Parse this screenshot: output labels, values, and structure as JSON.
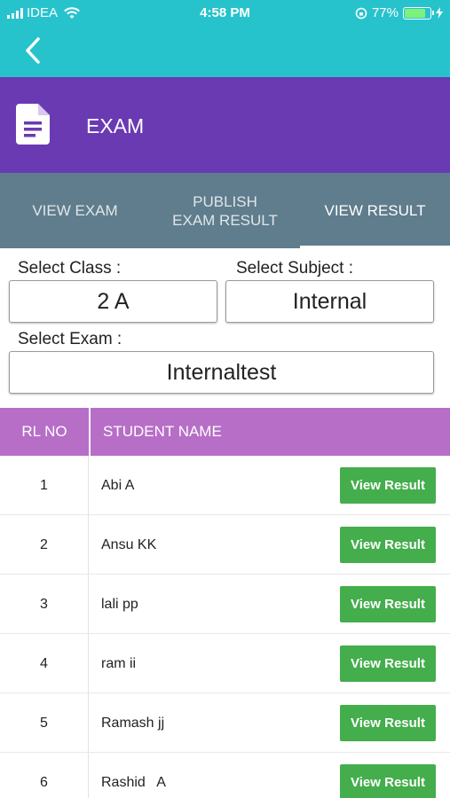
{
  "status_bar": {
    "carrier": "IDEA",
    "time": "4:58 PM",
    "battery": "77%",
    "icons": [
      "signal-icon",
      "wifi-icon",
      "orientation-lock-icon",
      "battery-icon",
      "charging-icon"
    ]
  },
  "nav": {
    "back_icon": "chevron-left-icon"
  },
  "header": {
    "icon": "document-icon",
    "title": "EXAM"
  },
  "tabs": [
    {
      "label": "VIEW EXAM",
      "active": false
    },
    {
      "label": "PUBLISH\nEXAM RESULT",
      "active": false
    },
    {
      "label": "VIEW RESULT",
      "active": true
    }
  ],
  "filters": {
    "class_label": "Select Class :",
    "class_value": "2 A",
    "subject_label": "Select Subject :",
    "subject_value": "Internal",
    "exam_label": "Select Exam :",
    "exam_value": "Internaltest"
  },
  "table": {
    "headers": [
      "RL NO",
      "STUDENT NAME"
    ],
    "rows": [
      {
        "rl": "1",
        "name": "Abi A",
        "button": "View Result"
      },
      {
        "rl": "2",
        "name": "Ansu KK",
        "button": "View Result"
      },
      {
        "rl": "3",
        "name": "lali pp",
        "button": "View Result"
      },
      {
        "rl": "4",
        "name": "ram ii",
        "button": "View Result"
      },
      {
        "rl": "5",
        "name": "Ramash jj",
        "button": "View Result"
      },
      {
        "rl": "6",
        "name": "Rashid   A",
        "button": "View Result"
      }
    ]
  },
  "colors": {
    "status_bar": "#27c3cc",
    "header": "#6a3ab3",
    "tabs": "#5f7d8c",
    "table_header": "#b76ec7",
    "button": "#44ad4c"
  }
}
